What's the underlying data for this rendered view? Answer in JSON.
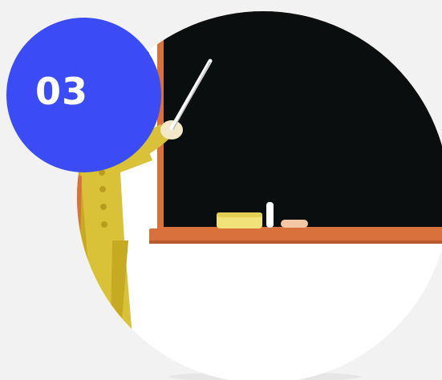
{
  "badge": {
    "number": "03"
  },
  "colors": {
    "background": "#f2f2f2",
    "badge": "#3b4bf5",
    "blackboard": "#0b0e0e",
    "board_frame": "#d9713d",
    "suit": "#d9c237",
    "floor": "#ffffff"
  },
  "illustration": {
    "subject": "teacher-with-pointer-at-blackboard"
  }
}
